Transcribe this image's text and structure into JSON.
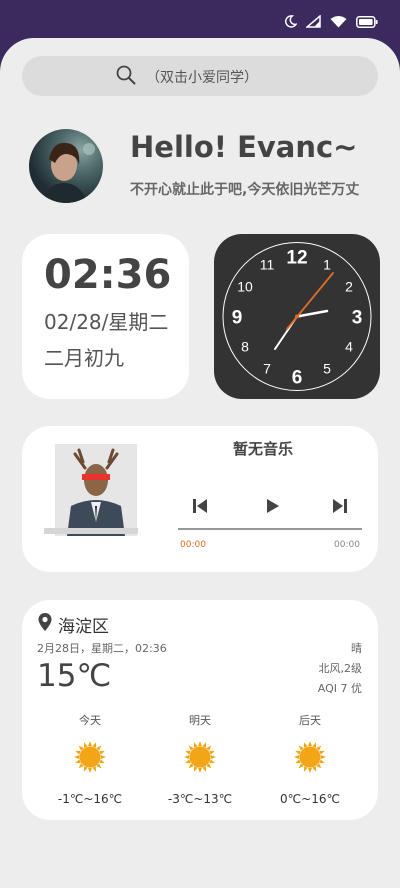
{
  "search": {
    "placeholder": "（双击小爱同学）"
  },
  "greeting": {
    "title": "Hello! Evanc~",
    "subtitle": "不开心就止此于吧,今天依旧光芒万丈"
  },
  "time_card": {
    "time": "02:36",
    "date": "02/28/星期二",
    "lunar": "二月初九"
  },
  "clock": {
    "numerals": [
      "12",
      "1",
      "2",
      "3",
      "4",
      "5",
      "6",
      "7",
      "8",
      "9",
      "10",
      "11"
    ],
    "time": "02:36"
  },
  "music": {
    "title": "暂无音乐",
    "elapsed": "00:00",
    "duration": "00:00"
  },
  "weather": {
    "location": "海淀区",
    "datetime": "2月28日，星期二，02:36",
    "temperature": "15℃",
    "condition": "晴",
    "wind": "北风,2级",
    "aqi": "AQI  7  优",
    "forecast": [
      {
        "day": "今天",
        "range": "-1℃~16℃",
        "icon": "sun-icon"
      },
      {
        "day": "明天",
        "range": "-3℃~13℃",
        "icon": "sun-icon"
      },
      {
        "day": "后天",
        "range": "0℃~16℃",
        "icon": "sun-icon"
      }
    ]
  },
  "colors": {
    "status_bar": "#3a2a5e",
    "background": "#ededed",
    "accent_orange": "#e06a2a",
    "sun": "#f2a516"
  }
}
